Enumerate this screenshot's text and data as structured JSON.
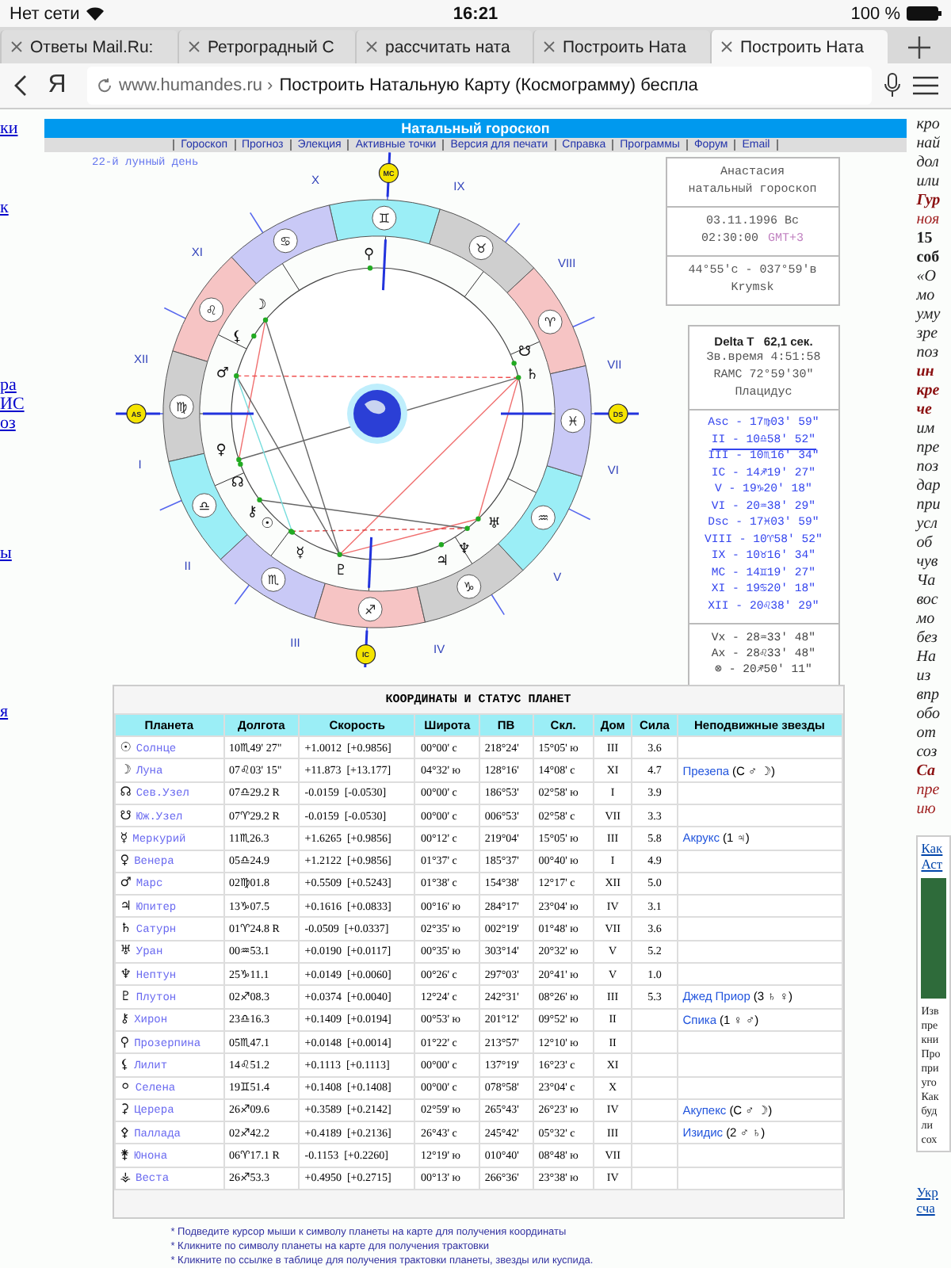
{
  "status_bar": {
    "carrier": "Нет сети",
    "time": "16:21",
    "battery": "100 %"
  },
  "tabs": [
    {
      "title": "Ответы Mail.Ru:",
      "selected": false
    },
    {
      "title": "Ретроградный С",
      "selected": false
    },
    {
      "title": "рассчитать ната",
      "selected": false
    },
    {
      "title": "Построить Ната",
      "selected": false
    },
    {
      "title": "Построить Ната",
      "selected": true
    }
  ],
  "address_bar": {
    "logo": "Я",
    "domain": "www.humandes.ru ›",
    "page_title": "Построить Натальную Карту (Космограмму) беспла"
  },
  "left_links": [
    "ки",
    "к",
    "ра",
    "ИС",
    "оз",
    "ы",
    "я"
  ],
  "site_header": {
    "title": "Натальный гороскоп",
    "nav": [
      "Гороскоп",
      "Прогноз",
      "Элекция",
      "Активные точки",
      "Версия для печати",
      "Справка",
      "Программы",
      "Форум",
      "Email"
    ]
  },
  "chart": {
    "lunar_day": "22-й лунный день",
    "houses": [
      "I",
      "II",
      "III",
      "IV",
      "V",
      "VI",
      "VII",
      "VIII",
      "IX",
      "X",
      "XI",
      "XII"
    ],
    "angles": [
      "AS",
      "IC",
      "DS",
      "MC"
    ],
    "zodiac": [
      {
        "glyph": "♈",
        "color": "#f6c4c4"
      },
      {
        "glyph": "♉",
        "color": "#cfcfcf"
      },
      {
        "glyph": "♊",
        "color": "#9beef6"
      },
      {
        "glyph": "♋",
        "color": "#c9c9f6"
      },
      {
        "glyph": "♌",
        "color": "#f6c4c4"
      },
      {
        "glyph": "♍",
        "color": "#cfcfcf"
      },
      {
        "glyph": "♎",
        "color": "#9beef6"
      },
      {
        "glyph": "♏",
        "color": "#c9c9f6"
      },
      {
        "glyph": "♐",
        "color": "#f6c4c4"
      },
      {
        "glyph": "♑",
        "color": "#cfcfcf"
      },
      {
        "glyph": "♒",
        "color": "#9beef6"
      },
      {
        "glyph": "♓",
        "color": "#c9c9f6"
      }
    ],
    "planets": [
      "☽",
      "⚸",
      "♂",
      "♀",
      "☊",
      "⚷",
      "☉",
      "☿",
      "♇",
      "♃",
      "♆",
      "♅",
      "♄",
      "☋",
      "⚲"
    ]
  },
  "info_box": {
    "name": "Анастасия",
    "subtitle": "натальный гороскоп",
    "date": "03.11.1996 Вс",
    "time": "02:30:00",
    "zone": "GMT+3",
    "coords": "44°55'с - 037°59'в",
    "place": "Krymsk"
  },
  "houses_box": {
    "delta_t": "Delta T   62,1 сек.",
    "sidereal": "Зв.время 4:51:58",
    "ramc": "RAMC 72°59'30\"",
    "system": "Плацидус",
    "cusps": [
      {
        "text": "Asc - 17♍03' 59\"",
        "selected": false
      },
      {
        "text": "II - 10♎58' 52\"",
        "selected": true
      },
      {
        "text": "III - 10♏16' 34\"",
        "selected": false
      },
      {
        "text": "IC - 14♐19' 27\"",
        "selected": false
      },
      {
        "text": "V - 19♑20' 18\"",
        "selected": false
      },
      {
        "text": "VI - 20♒38' 29\"",
        "selected": false
      },
      {
        "text": "Dsc - 17♓03' 59\"",
        "selected": false
      },
      {
        "text": "VIII - 10♈58' 52\"",
        "selected": false
      },
      {
        "text": "IX - 10♉16' 34\"",
        "selected": false
      },
      {
        "text": "MC - 14♊19' 27\"",
        "selected": false
      },
      {
        "text": "XI - 19♋20' 18\"",
        "selected": false
      },
      {
        "text": "XII - 20♌38' 29\"",
        "selected": false
      }
    ],
    "points": [
      "Vx - 28♒33' 48\"",
      "Ax - 28♌33' 48\"",
      "⊗ - 20♐50' 11\""
    ]
  },
  "table": {
    "title": "КООРДИНАТЫ И СТАТУС ПЛАНЕТ",
    "columns": [
      "Планета",
      "Долгота",
      "Скорость",
      "Широта",
      "ПВ",
      "Скл.",
      "Дом",
      "Сила",
      "Неподвижные звезды"
    ],
    "rows": [
      {
        "glyph": "☉",
        "name": "Солнце",
        "lon": "10♏49' 27\"",
        "speed": "+1.0012  [+0.9856]",
        "lat": "00°00' с",
        "pv": "218°24'",
        "decl": "15°05' ю",
        "house": "III",
        "power": "3.6"
      },
      {
        "glyph": "☽",
        "name": "Луна",
        "lon": "07♌03' 15\"",
        "speed": "+11.873  [+13.177]",
        "lat": "04°32' ю",
        "pv": "128°16'",
        "decl": "14°08' с",
        "house": "XI",
        "power": "4.7",
        "star": "Презепа",
        "star_info": "(С ♂ ☽)"
      },
      {
        "glyph": "☊",
        "name": "Сев.Узел",
        "lon": "07♎29.2  R",
        "speed": "-0.0159  [-0.0530]",
        "lat": "00°00' с",
        "pv": "186°53'",
        "decl": "02°58' ю",
        "house": "I",
        "power": "3.9"
      },
      {
        "glyph": "☋",
        "name": "Юж.Узел",
        "lon": "07♈29.2  R",
        "speed": "-0.0159  [-0.0530]",
        "lat": "00°00' с",
        "pv": "006°53'",
        "decl": "02°58' с",
        "house": "VII",
        "power": "3.3"
      },
      {
        "glyph": "☿",
        "name": "Меркурий",
        "lon": "11♏26.3",
        "speed": "+1.6265  [+0.9856]",
        "lat": "00°12' с",
        "pv": "219°04'",
        "decl": "15°05' ю",
        "house": "III",
        "power": "5.8",
        "star": "Акрукс",
        "star_info": "(1 ♃)"
      },
      {
        "glyph": "♀",
        "name": "Венера",
        "lon": "05♎24.9",
        "speed": "+1.2122  [+0.9856]",
        "lat": "01°37' с",
        "pv": "185°37'",
        "decl": "00°40' ю",
        "house": "I",
        "power": "4.9"
      },
      {
        "glyph": "♂",
        "name": "Марс",
        "lon": "02♍01.8",
        "speed": "+0.5509  [+0.5243]",
        "lat": "01°38' с",
        "pv": "154°38'",
        "decl": "12°17' с",
        "house": "XII",
        "power": "5.0"
      },
      {
        "glyph": "♃",
        "name": "Юпитер",
        "lon": "13♑07.5",
        "speed": "+0.1616  [+0.0833]",
        "lat": "00°16' ю",
        "pv": "284°17'",
        "decl": "23°04' ю",
        "house": "IV",
        "power": "3.1"
      },
      {
        "glyph": "♄",
        "name": "Сатурн",
        "lon": "01♈24.8  R",
        "speed": "-0.0509  [+0.0337]",
        "lat": "02°35' ю",
        "pv": "002°19'",
        "decl": "01°48' ю",
        "house": "VII",
        "power": "3.6"
      },
      {
        "glyph": "♅",
        "name": "Уран",
        "lon": "00♒53.1",
        "speed": "+0.0190  [+0.0117]",
        "lat": "00°35' ю",
        "pv": "303°14'",
        "decl": "20°32' ю",
        "house": "V",
        "power": "5.2"
      },
      {
        "glyph": "♆",
        "name": "Нептун",
        "lon": "25♑11.1",
        "speed": "+0.0149  [+0.0060]",
        "lat": "00°26' с",
        "pv": "297°03'",
        "decl": "20°41' ю",
        "house": "V",
        "power": "1.0"
      },
      {
        "glyph": "♇",
        "name": "Плутон",
        "lon": "02♐08.3",
        "speed": "+0.0374  [+0.0040]",
        "lat": "12°24' с",
        "pv": "242°31'",
        "decl": "08°26' ю",
        "house": "III",
        "power": "5.3",
        "star": "Джед Приор",
        "star_info": "(3 ♄ ♀)"
      },
      {
        "glyph": "⚷",
        "name": "Хирон",
        "lon": "23♎16.3",
        "speed": "+0.1409  [+0.0194]",
        "lat": "00°53' ю",
        "pv": "201°12'",
        "decl": "09°52' ю",
        "house": "II",
        "star": "Спика",
        "star_info": "(1 ♀ ♂)"
      },
      {
        "glyph": "⚲",
        "name": "Прозерпина",
        "lon": "05♏47.1",
        "speed": "+0.0148  [+0.0014]",
        "lat": "01°22' с",
        "pv": "213°57'",
        "decl": "12°10' ю",
        "house": "II"
      },
      {
        "glyph": "⚸",
        "name": "Лилит",
        "lon": "14♌51.2",
        "speed": "+0.1113  [+0.1113]",
        "lat": "00°00' с",
        "pv": "137°19'",
        "decl": "16°23' с",
        "house": "XI"
      },
      {
        "glyph": "⚪",
        "name": "Селена",
        "lon": "19♊51.4",
        "speed": "+0.1408  [+0.1408]",
        "lat": "00°00' с",
        "pv": "078°58'",
        "decl": "23°04' с",
        "house": "X"
      },
      {
        "glyph": "⚳",
        "name": "Церера",
        "lon": "26♐09.6",
        "speed": "+0.3589  [+0.2142]",
        "lat": "02°59' ю",
        "pv": "265°43'",
        "decl": "26°23' ю",
        "house": "IV",
        "star": "Акупекс",
        "star_info": "(С ♂ ☽)"
      },
      {
        "glyph": "⚴",
        "name": "Паллада",
        "lon": "02♐42.2",
        "speed": "+0.4189  [+0.2136]",
        "lat": "26°43' с",
        "pv": "245°42'",
        "decl": "05°32' с",
        "house": "III",
        "star": "Изидис",
        "star_info": "(2 ♂ ♄)"
      },
      {
        "glyph": "⚵",
        "name": "Юнона",
        "lon": "06♈17.1  R",
        "speed": "-0.1153  [+0.2260]",
        "lat": "12°19' ю",
        "pv": "010°40'",
        "decl": "08°48' ю",
        "house": "VII"
      },
      {
        "glyph": "⚶",
        "name": "Веста",
        "lon": "26♐53.3",
        "speed": "+0.4950  [+0.2715]",
        "lat": "00°13' ю",
        "pv": "266°36'",
        "decl": "23°38' ю",
        "house": "IV"
      }
    ]
  },
  "notes": [
    "* Подведите курсор мыши к символу планеты на карте для получения координаты",
    "* Кликните по символу планеты на карте для получения трактовки",
    "* Кликните по ссылке в таблице для получения трактовки планеты, звезды или куспида."
  ],
  "side_article": [
    {
      "text": "кро",
      "kind": "plain"
    },
    {
      "text": "най",
      "kind": "plain"
    },
    {
      "text": "дол",
      "kind": "plain"
    },
    {
      "text": "или",
      "kind": "plain"
    },
    {
      "text": "Гур",
      "kind": "accent"
    },
    {
      "text": "ноя",
      "kind": "red"
    },
    {
      "text": "15",
      "kind": "bold"
    },
    {
      "text": "соб",
      "kind": "bold"
    },
    {
      "text": "«О",
      "kind": "plain"
    },
    {
      "text": "мо",
      "kind": "plain"
    },
    {
      "text": "уму",
      "kind": "plain"
    },
    {
      "text": "зре",
      "kind": "plain"
    },
    {
      "text": "поз",
      "kind": "plain"
    },
    {
      "text": "ин",
      "kind": "accent"
    },
    {
      "text": "кре",
      "kind": "accent"
    },
    {
      "text": "че",
      "kind": "accent"
    },
    {
      "text": "им",
      "kind": "plain"
    },
    {
      "text": "пре",
      "kind": "plain"
    },
    {
      "text": "поз",
      "kind": "plain"
    },
    {
      "text": "дар",
      "kind": "plain"
    },
    {
      "text": "при",
      "kind": "plain"
    },
    {
      "text": "усл",
      "kind": "plain"
    },
    {
      "text": "об",
      "kind": "plain"
    },
    {
      "text": "чув",
      "kind": "plain"
    },
    {
      "text": "Ча",
      "kind": "plain"
    },
    {
      "text": "вос",
      "kind": "plain"
    },
    {
      "text": "мо",
      "kind": "plain"
    },
    {
      "text": "без",
      "kind": "plain"
    },
    {
      "text": "На",
      "kind": "plain"
    },
    {
      "text": "из",
      "kind": "plain"
    },
    {
      "text": "впр",
      "kind": "plain"
    },
    {
      "text": "обо",
      "kind": "plain"
    },
    {
      "text": "от",
      "kind": "plain"
    },
    {
      "text": "соз",
      "kind": "plain"
    },
    {
      "text": "Са",
      "kind": "accent"
    },
    {
      "text": "пре",
      "kind": "red"
    },
    {
      "text": "ию",
      "kind": "red"
    }
  ],
  "side_card": {
    "links": [
      "Как",
      "Аст"
    ],
    "lines": [
      "Изв",
      "пре",
      "кни",
      "Про",
      "при",
      "уго",
      "Как",
      "буд",
      "ли",
      "сох"
    ]
  },
  "side_bottom_links": [
    "Укр",
    "сча"
  ]
}
